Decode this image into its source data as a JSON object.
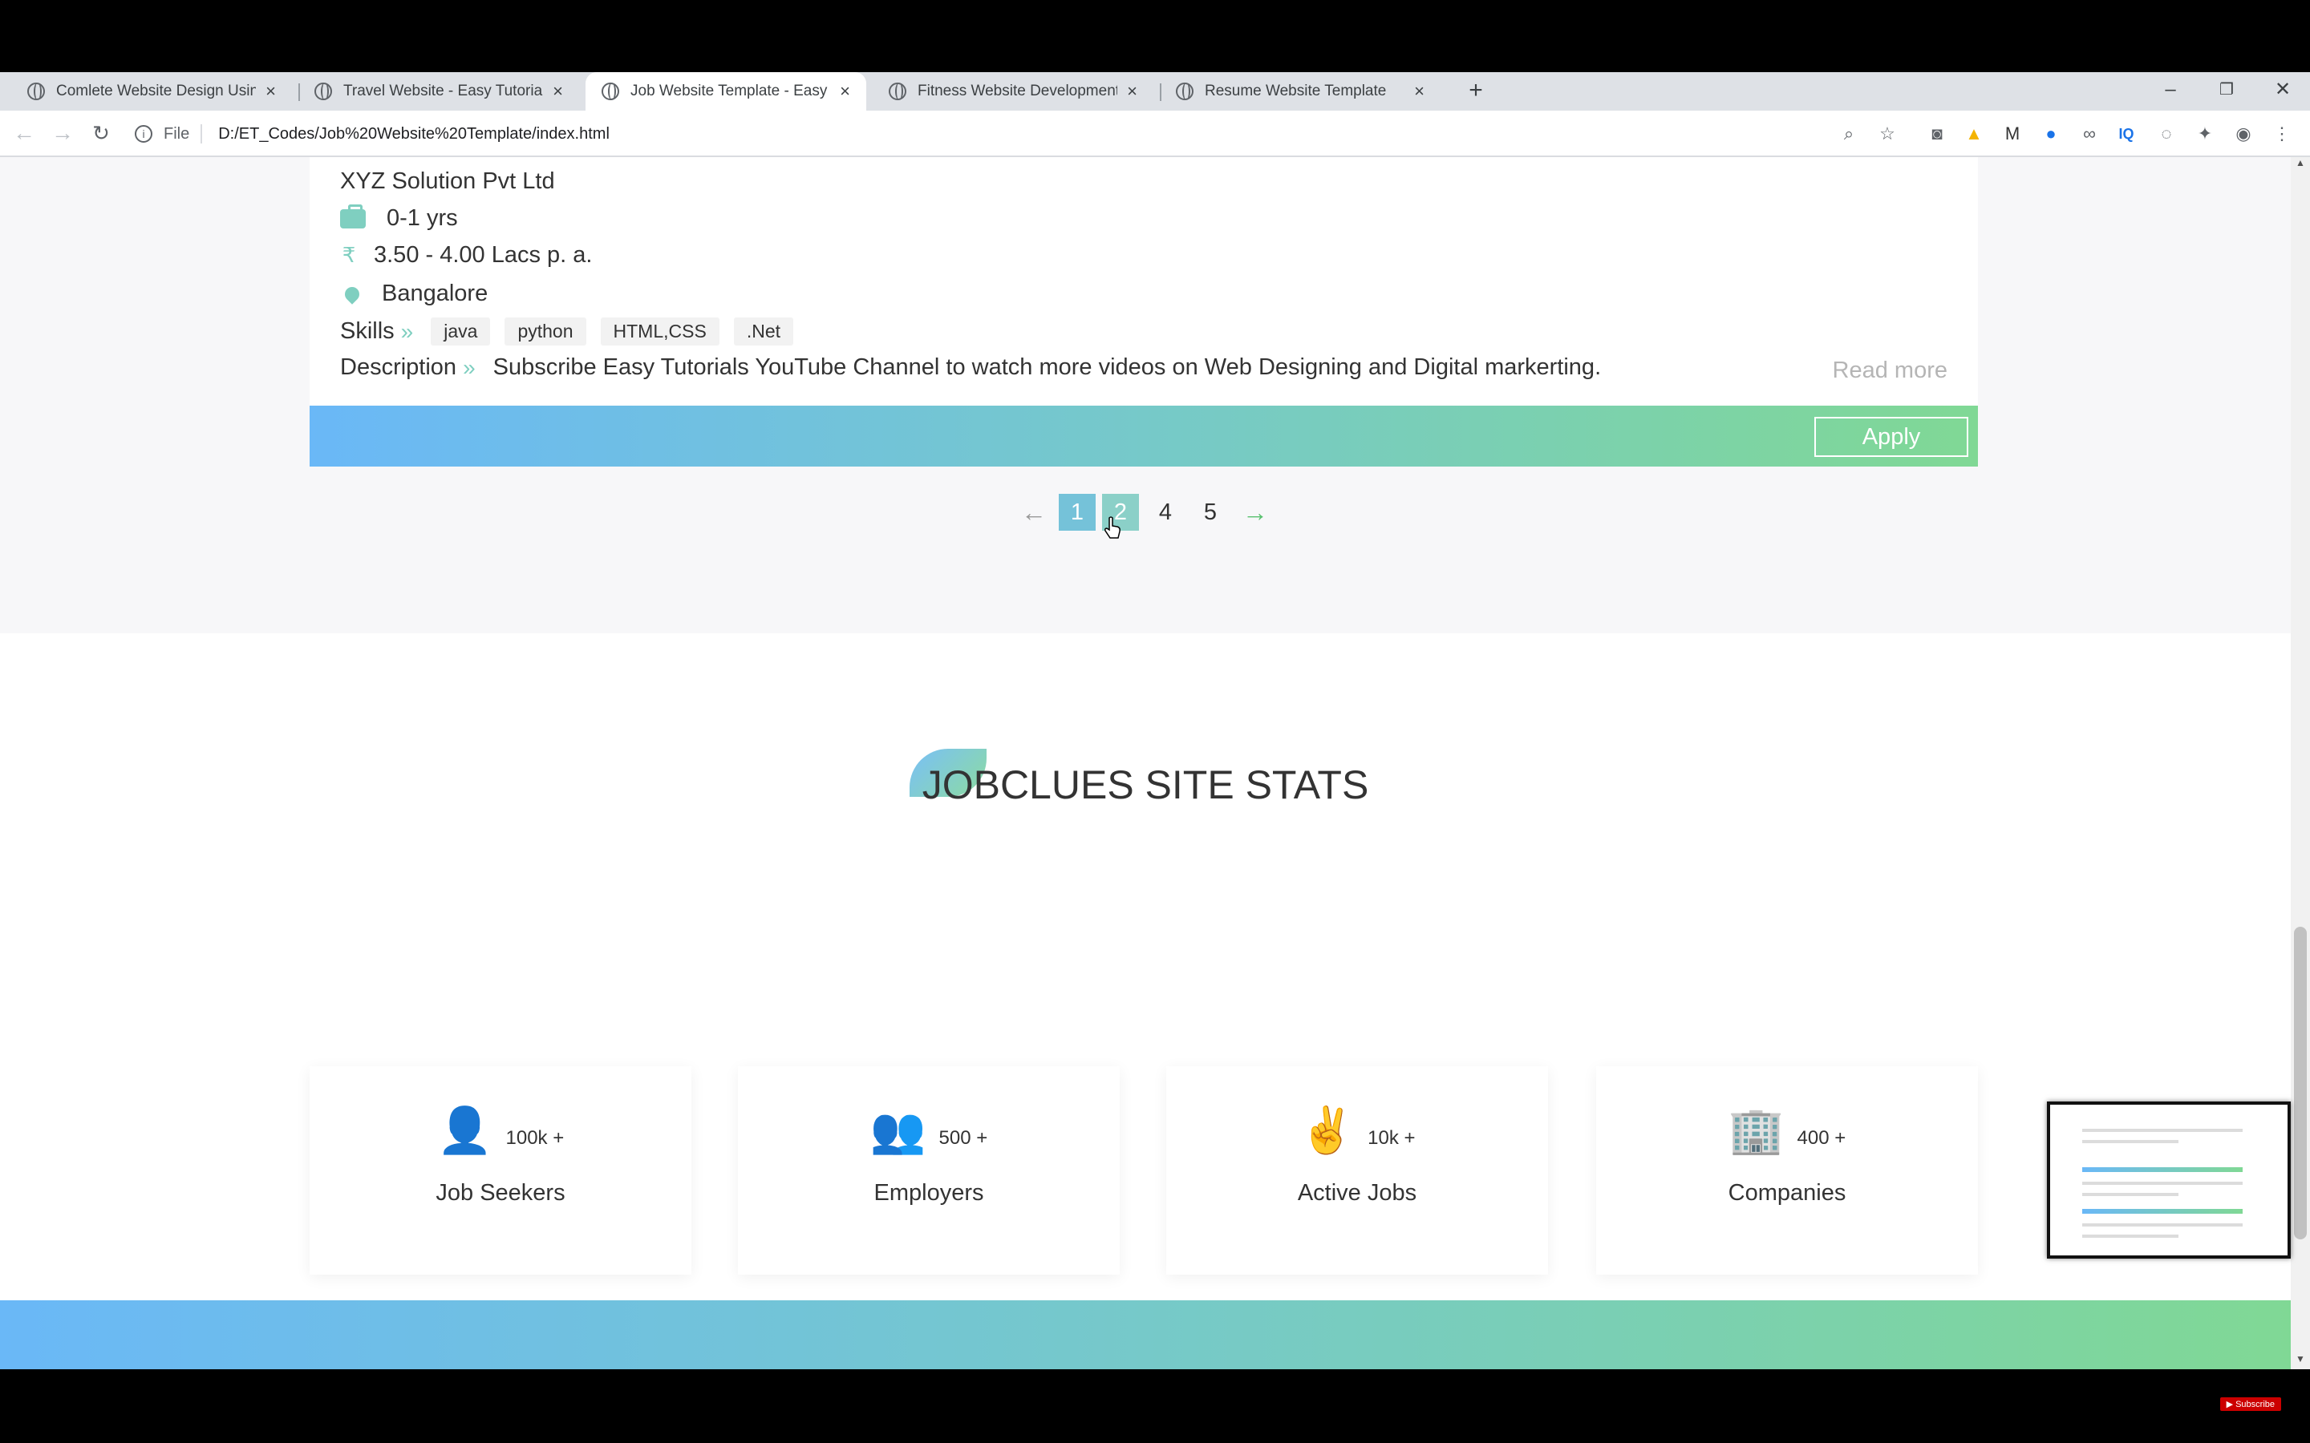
{
  "browser": {
    "tabs": [
      {
        "title": "Comlete Website Design Using H"
      },
      {
        "title": "Travel Website - Easy Tutorials"
      },
      {
        "title": "Job Website Template - Easy Tut"
      },
      {
        "title": "Fitness Website Development"
      },
      {
        "title": "Resume Website Template"
      }
    ],
    "active_tab": 2,
    "new_tab_label": "+",
    "address": {
      "scheme_label": "File",
      "url": "D:/ET_Codes/Job%20Website%20Template/index.html"
    },
    "window_controls": {
      "minimize": "–",
      "restore": "❐",
      "close": "✕"
    }
  },
  "job_card": {
    "company": "XYZ Solution Pvt Ltd",
    "experience": "0-1 yrs",
    "salary_symbol": "₹",
    "salary": "3.50 - 4.00 Lacs p. a.",
    "location": "Bangalore",
    "skills_label": "Skills",
    "skills": [
      "java",
      "python",
      "HTML,CSS",
      ".Net"
    ],
    "description_label": "Description",
    "description": "Subscribe Easy Tutorials YouTube Channel to watch more videos on Web Designing and Digital markerting.",
    "read_more": "Read more",
    "apply": "Apply",
    "chevron": "»"
  },
  "pagination": {
    "prev": "←",
    "pages": [
      "1",
      "2",
      "4",
      "5"
    ],
    "current": "1",
    "next": "→"
  },
  "stats": {
    "title": "JOBCLUES SITE STATS",
    "items": [
      {
        "icon": "user-icon",
        "glyph": "👤",
        "count": "100k +",
        "label": "Job Seekers"
      },
      {
        "icon": "employers-icon",
        "glyph": "👥",
        "count": "500 +",
        "label": "Employers"
      },
      {
        "icon": "hand-icon",
        "glyph": "✌",
        "count": "10k +",
        "label": "Active Jobs"
      },
      {
        "icon": "building-icon",
        "glyph": "🏢",
        "count": "400 +",
        "label": "Companies"
      }
    ]
  },
  "overlay": {
    "subscribe_badge": "▶ Subscribe"
  },
  "colors": {
    "accent_green": "#7fcfc0",
    "gradient_start": "#6ab8f7",
    "gradient_end": "#80d895",
    "page_bg": "#f7f7f9"
  }
}
